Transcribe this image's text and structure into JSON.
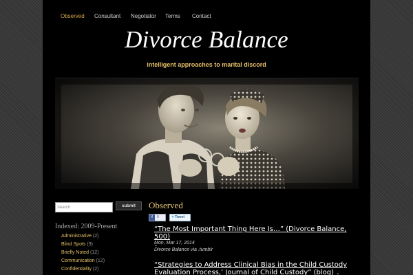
{
  "nav": {
    "items": [
      {
        "label": "Observed",
        "active": true
      },
      {
        "label": "Consultant",
        "active": false
      },
      {
        "label": "Negotiator",
        "active": false
      },
      {
        "label": "Terms",
        "active": false
      },
      {
        "label": "Contact",
        "active": false
      }
    ]
  },
  "site": {
    "title": "Divorce Balance",
    "tagline": "intelligent approaches to marital discord"
  },
  "search": {
    "placeholder": "Search",
    "button_label": "submit"
  },
  "sidebar": {
    "heading": "Indexed: 2009-Present",
    "categories": [
      {
        "label": "Administrative",
        "count": "(2)"
      },
      {
        "label": "Blind Spots",
        "count": "(9)"
      },
      {
        "label": "Briefly Noted",
        "count": "(12)"
      },
      {
        "label": "Communication",
        "count": "(12)"
      },
      {
        "label": "Confidentiality",
        "count": "(2)"
      }
    ]
  },
  "main": {
    "heading": "Observed",
    "share": {
      "like_count": "0",
      "tweet_label": "Tweet"
    },
    "posts": [
      {
        "title": "“The Most Important Thing Here Is…” (Divorce Balance, 500)",
        "date": "Mon, Mar 17, 2014",
        "via": "Divorce Balance via .tumblr"
      },
      {
        "title": "“Strategies to Address Clinical Bias in the Child Custody Evaluation Process,’ Journal of Child Custody” (blog)"
      }
    ]
  },
  "colors": {
    "accent": "#d4a64a",
    "tagline": "#e8c26a",
    "page_bg": "#000000"
  }
}
